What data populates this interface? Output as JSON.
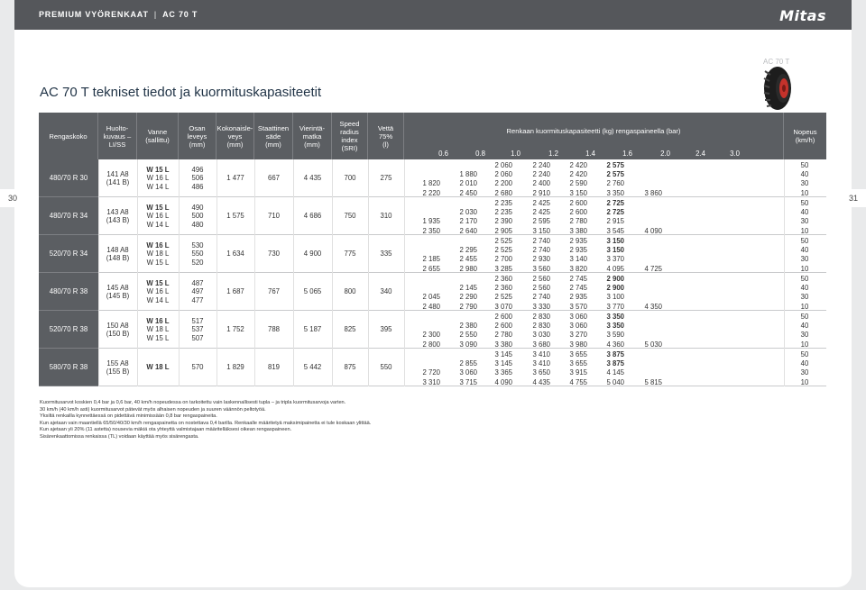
{
  "topbar": {
    "section": "PREMIUM VYÖRENKAAT",
    "product": "AC 70 T",
    "logo": "Mitas"
  },
  "page_numbers": {
    "left": "30",
    "right": "31"
  },
  "product_tag": "AC 70 T",
  "title": "AC 70 T tekniset tiedot ja kuormituskapasiteetit",
  "headers": {
    "size": "Rengaskoko",
    "service": [
      "Huolto-",
      "kuvaus –",
      "LI/SS"
    ],
    "rim": [
      "Vanne",
      "(sallittu)"
    ],
    "width": [
      "Osan",
      "leveys",
      "(mm)"
    ],
    "height": [
      "Kokonaisle-",
      "veys",
      "(mm)"
    ],
    "radius": [
      "Staattinen",
      "säde",
      "(mm)"
    ],
    "rolling": [
      "Vierintä-",
      "matka",
      "(mm)"
    ],
    "sri": [
      "Speed",
      "radius",
      "index",
      "(SRI)"
    ],
    "water": [
      "Vettä",
      "75%",
      "(l)"
    ],
    "load": "Renkaan kuormituskapasiteetti (kg) rengaspaineella (bar)",
    "pressures": [
      "0.6",
      "0.8",
      "1.0",
      "1.2",
      "1.4",
      "1.6",
      "2.0",
      "2.4",
      "3.0"
    ],
    "speed": [
      "Nopeus",
      "(km/h)"
    ]
  },
  "rows": [
    {
      "size": "480/70 R 30",
      "service": [
        "141 A8",
        "(141 B)"
      ],
      "rims": [
        "W 15 L",
        "W 16 L",
        "W 14 L"
      ],
      "widths": [
        "496",
        "506",
        "486"
      ],
      "height": "1 477",
      "radius": "667",
      "rolling": "4 435",
      "sri": "700",
      "water": "275",
      "loads": [
        [
          "",
          "",
          "2 060",
          "2 240",
          "2 420",
          "2 575",
          "",
          "",
          ""
        ],
        [
          "",
          "1 880",
          "2 060",
          "2 240",
          "2 420",
          "2 575",
          "",
          "",
          ""
        ],
        [
          "1 820",
          "2 010",
          "2 200",
          "2 400",
          "2 590",
          "2 760",
          "",
          "",
          ""
        ],
        [
          "2 220",
          "2 450",
          "2 680",
          "2 910",
          "3 150",
          "3 350",
          "3 860",
          "",
          ""
        ]
      ],
      "bold": [
        [
          false,
          false,
          false,
          false,
          false,
          true
        ],
        [
          false,
          false,
          false,
          false,
          false,
          true
        ],
        [
          false,
          false,
          false,
          false,
          false,
          false
        ],
        [
          false,
          false,
          false,
          false,
          false,
          false
        ]
      ],
      "speeds": [
        "50",
        "40",
        "30",
        "10"
      ]
    },
    {
      "size": "480/70 R 34",
      "service": [
        "143 A8",
        "(143 B)"
      ],
      "rims": [
        "W 15 L",
        "W 16 L",
        "W 14 L"
      ],
      "widths": [
        "490",
        "500",
        "480"
      ],
      "height": "1 575",
      "radius": "710",
      "rolling": "4 686",
      "sri": "750",
      "water": "310",
      "loads": [
        [
          "",
          "",
          "2 235",
          "2 425",
          "2 600",
          "2 725",
          "",
          "",
          ""
        ],
        [
          "",
          "2 030",
          "2 235",
          "2 425",
          "2 600",
          "2 725",
          "",
          "",
          ""
        ],
        [
          "1 935",
          "2 170",
          "2 390",
          "2 595",
          "2 780",
          "2 915",
          "",
          "",
          ""
        ],
        [
          "2 350",
          "2 640",
          "2 905",
          "3 150",
          "3 380",
          "3 545",
          "4 090",
          "",
          ""
        ]
      ],
      "speeds": [
        "50",
        "40",
        "30",
        "10"
      ]
    },
    {
      "size": "520/70 R 34",
      "service": [
        "148 A8",
        "(148 B)"
      ],
      "rims": [
        "W 16 L",
        "W 18 L",
        "W 15 L"
      ],
      "widths": [
        "530",
        "550",
        "520"
      ],
      "height": "1 634",
      "radius": "730",
      "rolling": "4 900",
      "sri": "775",
      "water": "335",
      "loads": [
        [
          "",
          "",
          "2 525",
          "2 740",
          "2 935",
          "3 150",
          "",
          "",
          ""
        ],
        [
          "",
          "2 295",
          "2 525",
          "2 740",
          "2 935",
          "3 150",
          "",
          "",
          ""
        ],
        [
          "2 185",
          "2 455",
          "2 700",
          "2 930",
          "3 140",
          "3 370",
          "",
          "",
          ""
        ],
        [
          "2 655",
          "2 980",
          "3 285",
          "3 560",
          "3 820",
          "4 095",
          "4 725",
          "",
          ""
        ]
      ],
      "speeds": [
        "50",
        "40",
        "30",
        "10"
      ]
    },
    {
      "size": "480/70 R 38",
      "service": [
        "145 A8",
        "(145 B)"
      ],
      "rims": [
        "W 15 L",
        "W 16 L",
        "W 14 L"
      ],
      "widths": [
        "487",
        "497",
        "477"
      ],
      "height": "1 687",
      "radius": "767",
      "rolling": "5 065",
      "sri": "800",
      "water": "340",
      "loads": [
        [
          "",
          "",
          "2 360",
          "2 560",
          "2 745",
          "2 900",
          "",
          "",
          ""
        ],
        [
          "",
          "2 145",
          "2 360",
          "2 560",
          "2 745",
          "2 900",
          "",
          "",
          ""
        ],
        [
          "2 045",
          "2 290",
          "2 525",
          "2 740",
          "2 935",
          "3 100",
          "",
          "",
          ""
        ],
        [
          "2 480",
          "2 790",
          "3 070",
          "3 330",
          "3 570",
          "3 770",
          "4 350",
          "",
          ""
        ]
      ],
      "speeds": [
        "50",
        "40",
        "30",
        "10"
      ]
    },
    {
      "size": "520/70 R 38",
      "service": [
        "150 A8",
        "(150 B)"
      ],
      "rims": [
        "W 16 L",
        "W 18 L",
        "W 15 L"
      ],
      "widths": [
        "517",
        "537",
        "507"
      ],
      "height": "1 752",
      "radius": "788",
      "rolling": "5 187",
      "sri": "825",
      "water": "395",
      "loads": [
        [
          "",
          "",
          "2 600",
          "2 830",
          "3 060",
          "3 350",
          "",
          "",
          ""
        ],
        [
          "",
          "2 380",
          "2 600",
          "2 830",
          "3 060",
          "3 350",
          "",
          "",
          ""
        ],
        [
          "2 300",
          "2 550",
          "2 780",
          "3 030",
          "3 270",
          "3 590",
          "",
          "",
          ""
        ],
        [
          "2 800",
          "3 090",
          "3 380",
          "3 680",
          "3 980",
          "4 360",
          "5 030",
          "",
          ""
        ]
      ],
      "speeds": [
        "50",
        "40",
        "30",
        "10"
      ]
    },
    {
      "size": "580/70 R 38",
      "service": [
        "155 A8",
        "(155 B)"
      ],
      "rims": [
        "W 18 L"
      ],
      "widths": [
        "570"
      ],
      "height": "1 829",
      "radius": "819",
      "rolling": "5 442",
      "sri": "875",
      "water": "550",
      "loads": [
        [
          "",
          "",
          "3 145",
          "3 410",
          "3 655",
          "3 875",
          "",
          "",
          ""
        ],
        [
          "",
          "2 855",
          "3 145",
          "3 410",
          "3 655",
          "3 875",
          "",
          "",
          ""
        ],
        [
          "2 720",
          "3 060",
          "3 365",
          "3 650",
          "3 915",
          "4 145",
          "",
          "",
          ""
        ],
        [
          "3 310",
          "3 715",
          "4 090",
          "4 435",
          "4 755",
          "5 040",
          "5 815",
          "",
          ""
        ]
      ],
      "speeds": [
        "50",
        "40",
        "30",
        "10"
      ]
    }
  ],
  "notes": [
    "Kuormitusarvot koskien 0,4 bar ja 0,6 bar, 40 km/h nopeudessa on tarkoitettu vain laskennallisesti tupla – ja tripla kuormitusarvoja varten.",
    "30 km/h (40 km/h asti) kuormitusarvot pätevät myös alhaisen nopeuden ja suuren väännön peltotyöä.",
    "Yksiltä renkailla kynnettäessä on pidettävä minimissään 0,8 bar rengaspaineita.",
    "Kun ajetaan vain maantiellä 65/50/40/30 km/h rengaspainetta on nostettava 0,4 barilla. Renkaalle määritetyä maksimipainetta ei tule koskaan ylittää.",
    "Kun ajetaan yli 20% (11 astetta) nousevia mäkiä ota yhteyttä valmistajaan määritelläksesi oikean rengaspaineen.",
    "Sisärenkaattomissa renkaissa (TL) voidaan käyttää myös sisärengasta."
  ]
}
